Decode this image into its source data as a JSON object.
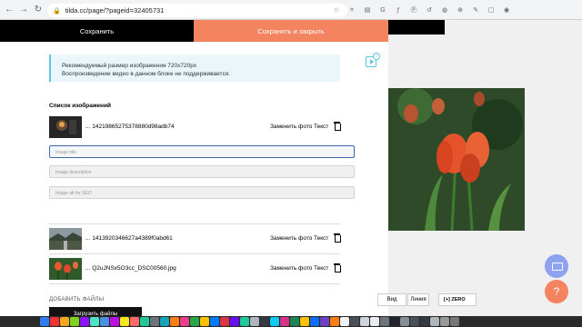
{
  "browser": {
    "url": "tilda.cc/page/?pageid=32405731",
    "extensions": [
      "☆",
      "⌾",
      "▤",
      "G",
      "ƒ",
      "Ⓟ",
      "↺",
      "◍",
      "⊕",
      "✎",
      "▢",
      "◉"
    ],
    "nav_back": "←",
    "nav_forward": "→",
    "nav_reload": "↻",
    "lock": "🔒"
  },
  "modal": {
    "save_label": "Сохранить",
    "save_close_label": "Сохранить и закрыть",
    "info_line1": "Рекомендуемый размер изображения 720x720px",
    "info_line2": "Воспроизведение видео в данном блоке не поддерживается.",
    "video_badge": "i",
    "list_title": "Список изображений",
    "images": [
      {
        "filename": "... 14219865275378880d98adb74",
        "replace": "Заменить фото",
        "text": "Текст"
      },
      {
        "filename": "... 1413920346627a4389f0abd61",
        "replace": "Заменить фото",
        "text": "Текст"
      },
      {
        "filename": "... Q2uJNSx5O3cc_DSC00560.jpg",
        "replace": "Заменить фото",
        "text": "Текст"
      }
    ],
    "fields": {
      "title_placeholder": "Image title",
      "description_placeholder": "Image description",
      "alt_placeholder": "Image alt for SEO"
    },
    "add_files_label": "ДОБАВИТЬ ФАЙЛЫ",
    "upload_label": "Загрузить файлы"
  },
  "editor": {
    "view_label": "Вид",
    "line_label": "Линия",
    "zero_label": "ZERO",
    "zero_icon": "[+]",
    "help_icon": "?"
  },
  "colors": {
    "accent_orange": "#f4845f",
    "info_blue": "#5ec4e0",
    "assistant_blue": "#8fa2ef"
  }
}
